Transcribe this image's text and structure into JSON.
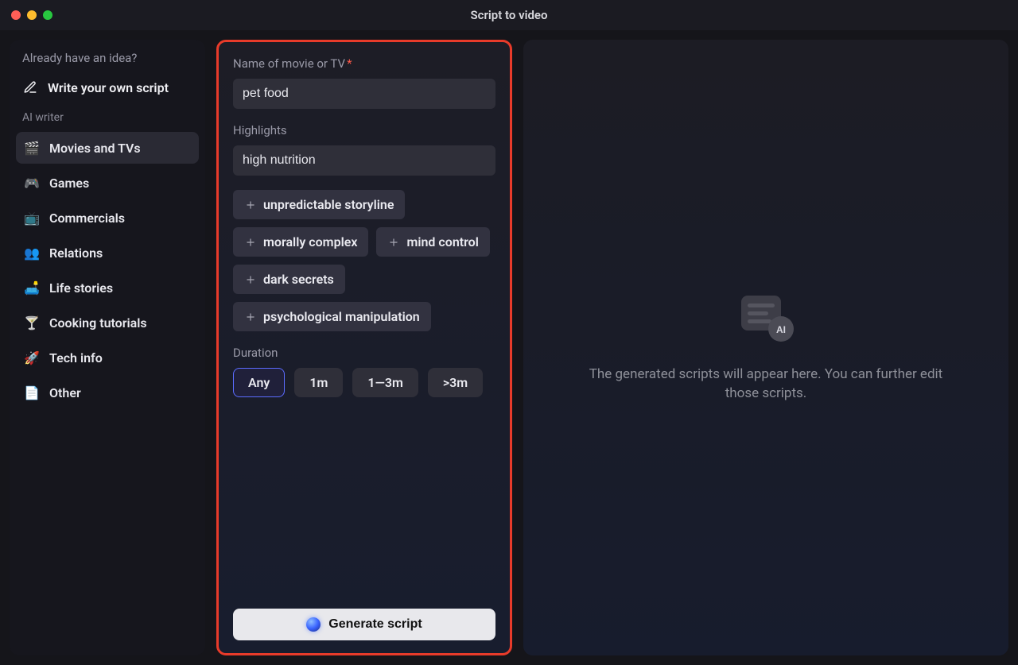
{
  "window": {
    "title": "Script to video"
  },
  "sidebar": {
    "idea_heading": "Already have an idea?",
    "write_own": "Write your own script",
    "ai_writer_heading": "AI writer",
    "items": [
      {
        "label": "Movies and TVs",
        "icon": "🎬",
        "active": true
      },
      {
        "label": "Games",
        "icon": "🎮",
        "active": false
      },
      {
        "label": "Commercials",
        "icon": "📺",
        "active": false
      },
      {
        "label": "Relations",
        "icon": "👥",
        "active": false
      },
      {
        "label": "Life stories",
        "icon": "🛋️",
        "active": false
      },
      {
        "label": "Cooking tutorials",
        "icon": "🍸",
        "active": false
      },
      {
        "label": "Tech info",
        "icon": "🚀",
        "active": false
      },
      {
        "label": "Other",
        "icon": "📄",
        "active": false
      }
    ]
  },
  "form": {
    "name_label": "Name of movie or TV",
    "name_value": "pet food",
    "highlights_label": "Highlights",
    "highlights_value": "high nutrition",
    "suggestions": [
      "unpredictable storyline",
      "morally complex",
      "mind control",
      "dark secrets",
      "psychological manipulation"
    ],
    "duration_label": "Duration",
    "durations": [
      {
        "label": "Any",
        "active": true
      },
      {
        "label": "1m",
        "active": false
      },
      {
        "label": "1—3m",
        "active": false
      },
      {
        "label": ">3m",
        "active": false
      }
    ],
    "generate_label": "Generate script"
  },
  "preview": {
    "placeholder_text": "The generated scripts will appear here. You can further edit those scripts."
  }
}
